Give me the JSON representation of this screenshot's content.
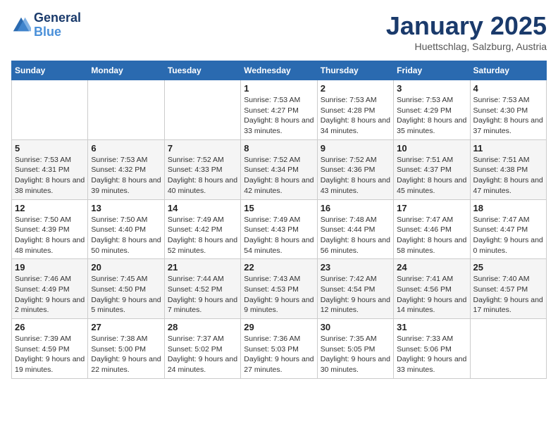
{
  "logo": {
    "line1": "General",
    "line2": "Blue"
  },
  "title": "January 2025",
  "subtitle": "Huettschlag, Salzburg, Austria",
  "weekdays": [
    "Sunday",
    "Monday",
    "Tuesday",
    "Wednesday",
    "Thursday",
    "Friday",
    "Saturday"
  ],
  "weeks": [
    [
      null,
      null,
      null,
      {
        "day": "1",
        "sunrise": "7:53 AM",
        "sunset": "4:27 PM",
        "daylight": "8 hours and 33 minutes."
      },
      {
        "day": "2",
        "sunrise": "7:53 AM",
        "sunset": "4:28 PM",
        "daylight": "8 hours and 34 minutes."
      },
      {
        "day": "3",
        "sunrise": "7:53 AM",
        "sunset": "4:29 PM",
        "daylight": "8 hours and 35 minutes."
      },
      {
        "day": "4",
        "sunrise": "7:53 AM",
        "sunset": "4:30 PM",
        "daylight": "8 hours and 37 minutes."
      }
    ],
    [
      {
        "day": "5",
        "sunrise": "7:53 AM",
        "sunset": "4:31 PM",
        "daylight": "8 hours and 38 minutes."
      },
      {
        "day": "6",
        "sunrise": "7:53 AM",
        "sunset": "4:32 PM",
        "daylight": "8 hours and 39 minutes."
      },
      {
        "day": "7",
        "sunrise": "7:52 AM",
        "sunset": "4:33 PM",
        "daylight": "8 hours and 40 minutes."
      },
      {
        "day": "8",
        "sunrise": "7:52 AM",
        "sunset": "4:34 PM",
        "daylight": "8 hours and 42 minutes."
      },
      {
        "day": "9",
        "sunrise": "7:52 AM",
        "sunset": "4:36 PM",
        "daylight": "8 hours and 43 minutes."
      },
      {
        "day": "10",
        "sunrise": "7:51 AM",
        "sunset": "4:37 PM",
        "daylight": "8 hours and 45 minutes."
      },
      {
        "day": "11",
        "sunrise": "7:51 AM",
        "sunset": "4:38 PM",
        "daylight": "8 hours and 47 minutes."
      }
    ],
    [
      {
        "day": "12",
        "sunrise": "7:50 AM",
        "sunset": "4:39 PM",
        "daylight": "8 hours and 48 minutes."
      },
      {
        "day": "13",
        "sunrise": "7:50 AM",
        "sunset": "4:40 PM",
        "daylight": "8 hours and 50 minutes."
      },
      {
        "day": "14",
        "sunrise": "7:49 AM",
        "sunset": "4:42 PM",
        "daylight": "8 hours and 52 minutes."
      },
      {
        "day": "15",
        "sunrise": "7:49 AM",
        "sunset": "4:43 PM",
        "daylight": "8 hours and 54 minutes."
      },
      {
        "day": "16",
        "sunrise": "7:48 AM",
        "sunset": "4:44 PM",
        "daylight": "8 hours and 56 minutes."
      },
      {
        "day": "17",
        "sunrise": "7:47 AM",
        "sunset": "4:46 PM",
        "daylight": "8 hours and 58 minutes."
      },
      {
        "day": "18",
        "sunrise": "7:47 AM",
        "sunset": "4:47 PM",
        "daylight": "9 hours and 0 minutes."
      }
    ],
    [
      {
        "day": "19",
        "sunrise": "7:46 AM",
        "sunset": "4:49 PM",
        "daylight": "9 hours and 2 minutes."
      },
      {
        "day": "20",
        "sunrise": "7:45 AM",
        "sunset": "4:50 PM",
        "daylight": "9 hours and 5 minutes."
      },
      {
        "day": "21",
        "sunrise": "7:44 AM",
        "sunset": "4:52 PM",
        "daylight": "9 hours and 7 minutes."
      },
      {
        "day": "22",
        "sunrise": "7:43 AM",
        "sunset": "4:53 PM",
        "daylight": "9 hours and 9 minutes."
      },
      {
        "day": "23",
        "sunrise": "7:42 AM",
        "sunset": "4:54 PM",
        "daylight": "9 hours and 12 minutes."
      },
      {
        "day": "24",
        "sunrise": "7:41 AM",
        "sunset": "4:56 PM",
        "daylight": "9 hours and 14 minutes."
      },
      {
        "day": "25",
        "sunrise": "7:40 AM",
        "sunset": "4:57 PM",
        "daylight": "9 hours and 17 minutes."
      }
    ],
    [
      {
        "day": "26",
        "sunrise": "7:39 AM",
        "sunset": "4:59 PM",
        "daylight": "9 hours and 19 minutes."
      },
      {
        "day": "27",
        "sunrise": "7:38 AM",
        "sunset": "5:00 PM",
        "daylight": "9 hours and 22 minutes."
      },
      {
        "day": "28",
        "sunrise": "7:37 AM",
        "sunset": "5:02 PM",
        "daylight": "9 hours and 24 minutes."
      },
      {
        "day": "29",
        "sunrise": "7:36 AM",
        "sunset": "5:03 PM",
        "daylight": "9 hours and 27 minutes."
      },
      {
        "day": "30",
        "sunrise": "7:35 AM",
        "sunset": "5:05 PM",
        "daylight": "9 hours and 30 minutes."
      },
      {
        "day": "31",
        "sunrise": "7:33 AM",
        "sunset": "5:06 PM",
        "daylight": "9 hours and 33 minutes."
      },
      null
    ]
  ]
}
